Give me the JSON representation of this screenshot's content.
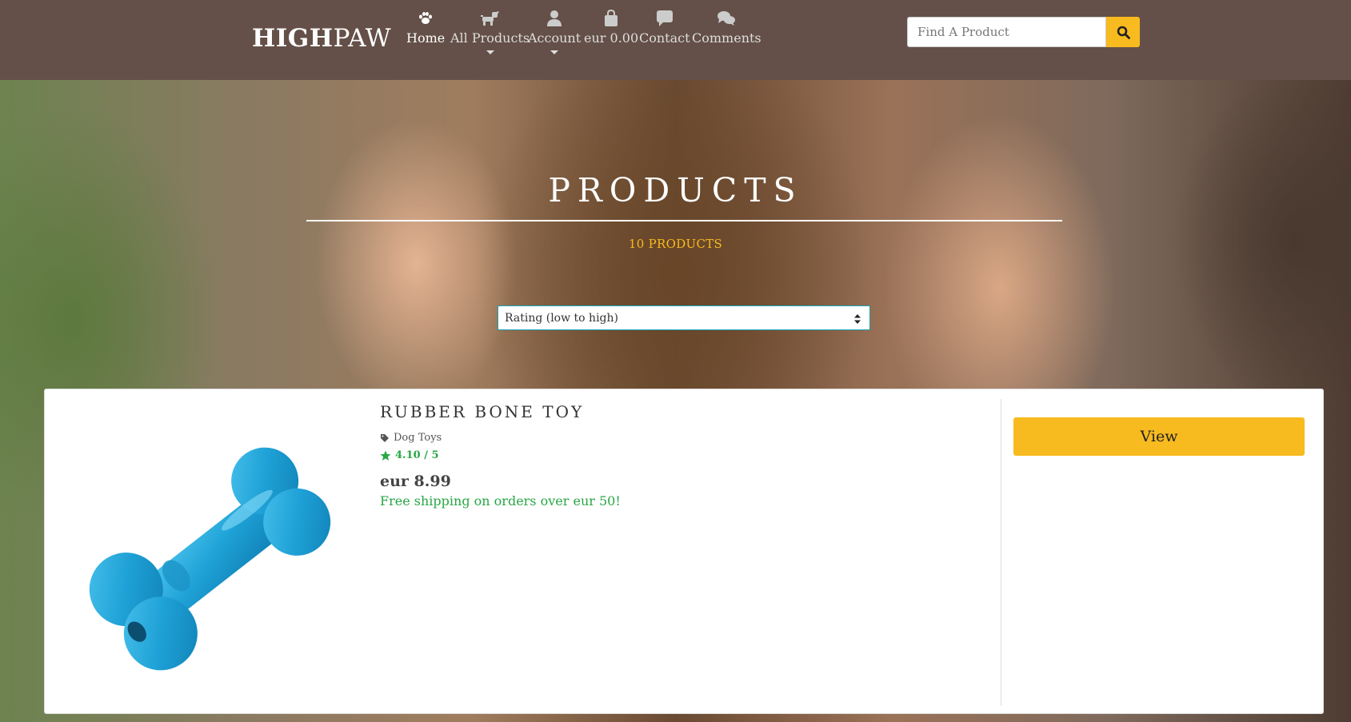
{
  "header": {
    "brand_bold": "HIGH",
    "brand_thin": "PAW",
    "nav": [
      {
        "label": "Home",
        "icon": "paw-icon",
        "active": true
      },
      {
        "label": "All Products",
        "icon": "dog-icon",
        "dropdown": true
      },
      {
        "label": "Account",
        "icon": "user-icon",
        "dropdown": true
      },
      {
        "label": "eur 0.00",
        "icon": "shopping-bag-icon"
      },
      {
        "label": "Contact",
        "icon": "comment-icon"
      },
      {
        "label": "Comments",
        "icon": "comments-icon"
      }
    ],
    "search": {
      "placeholder": "Find A Product",
      "button_icon": "search-icon"
    }
  },
  "hero": {
    "title": "PRODUCTS",
    "count": "10 PRODUCTS",
    "sort": {
      "selected": "Rating (low to high)"
    }
  },
  "products": [
    {
      "title": "RUBBER BONE TOY",
      "category": "Dog Toys",
      "rating": "4.10 / 5",
      "price": "eur 8.99",
      "shipping": "Free shipping on orders over eur 50!",
      "view_label": "View",
      "image_icon": "rubber-bone-image"
    }
  ],
  "colors": {
    "header_bg": "#645048",
    "accent": "#f8bb1f",
    "success": "#28a745",
    "select_border": "#17a2b8"
  }
}
